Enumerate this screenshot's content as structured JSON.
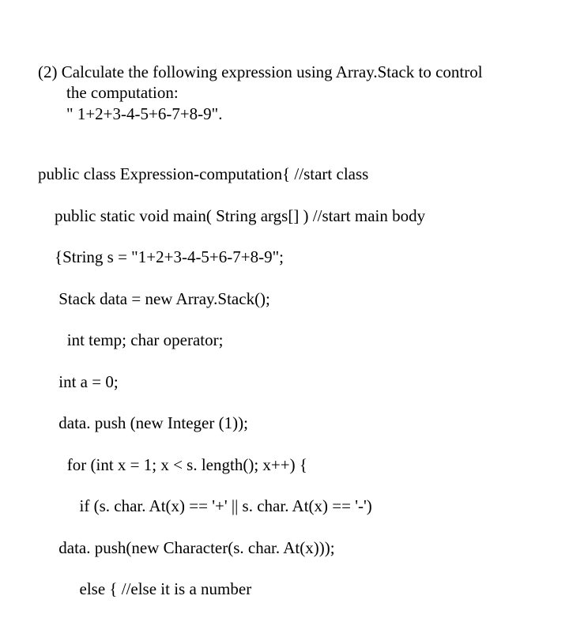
{
  "prompt": {
    "line1": "(2) Calculate the following expression using Array.Stack to control",
    "line2": "the computation:",
    "line3": "\" 1+2+3-4-5+6-7+8-9\"."
  },
  "code": {
    "l1": "public class Expression-computation{ //start class",
    "l2": "    public static void main( String args[] ) //start main body",
    "l3": "    {String s = \"1+2+3-4-5+6-7+8-9\";",
    "l4": "     Stack data = new Array.Stack();",
    "l5": "       int temp; char operator;",
    "l6": "     int a = 0;",
    "l7": "     data. push (new Integer (1));",
    "l8": "       for (int x = 1; x < s. length(); x++) {",
    "l9": "          if (s. char. At(x) == '+' || s. char. At(x) == '-')",
    "l10": "     data. push(new Character(s. char. At(x)));",
    "l11": "          else { //else it is a number"
  }
}
